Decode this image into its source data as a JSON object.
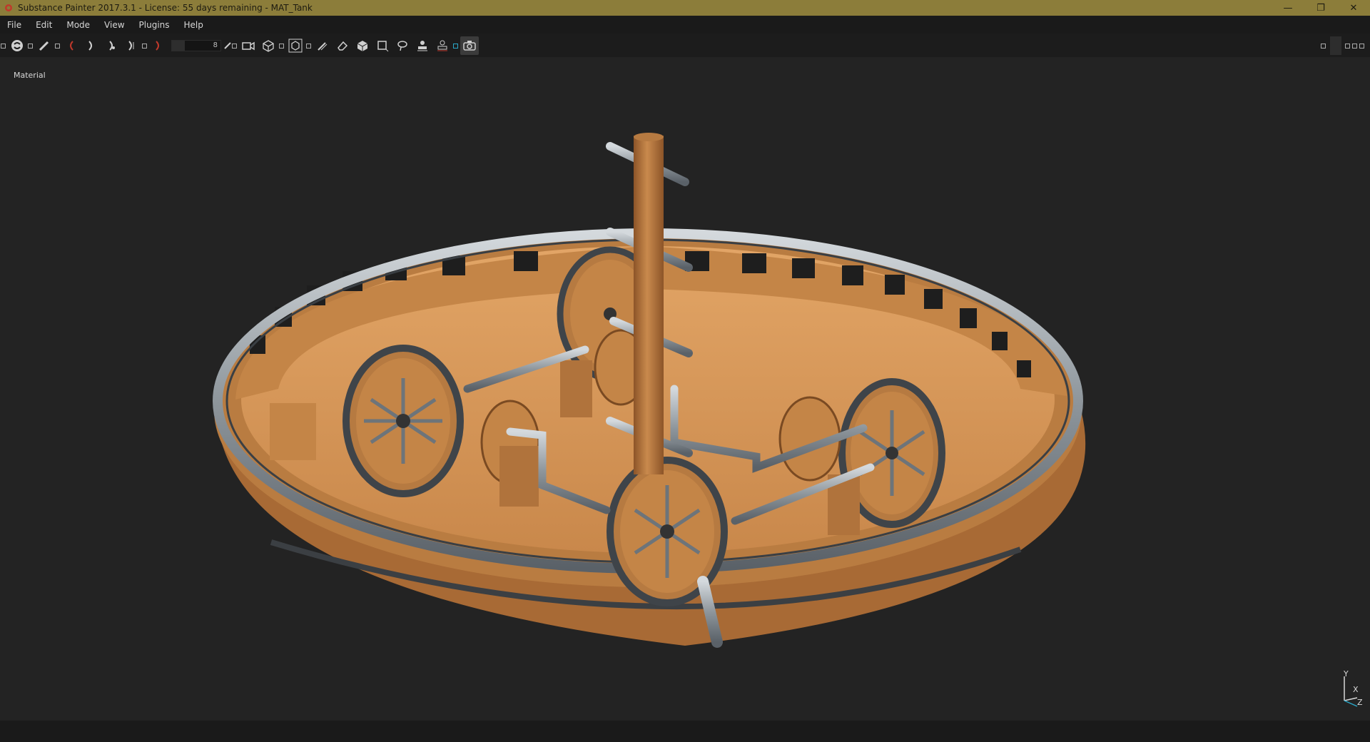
{
  "window": {
    "title": "Substance Painter 2017.3.1 - License: 55 days remaining - MAT_Tank",
    "controls": {
      "minimize": "—",
      "restore": "❐",
      "close": "✕"
    }
  },
  "menu": {
    "items": [
      "File",
      "Edit",
      "Mode",
      "View",
      "Plugins",
      "Help"
    ]
  },
  "toolbar": {
    "slider_value": "8",
    "icons": [
      "substance-logo-icon",
      "paint-brush-icon",
      "brace-left-icon",
      "brace-right-icon",
      "clone-icon",
      "smudge-icon",
      "camera-icon",
      "cube-icon",
      "cube-select-icon",
      "projection-icon",
      "eraser-icon",
      "geometry-icon",
      "polygon-fill-icon",
      "lasso-icon",
      "stamp-icon",
      "stamp-alt-icon",
      "screenshot-icon"
    ]
  },
  "viewport": {
    "label": "Material",
    "axes": {
      "y": "Y",
      "x": "X",
      "z": "Z"
    }
  },
  "colors": {
    "titlebar": "#8c7d3a",
    "menubar": "#1a1a1a",
    "viewport": "#232323",
    "wood": "#c88a4e",
    "metal": "#8d959c"
  }
}
